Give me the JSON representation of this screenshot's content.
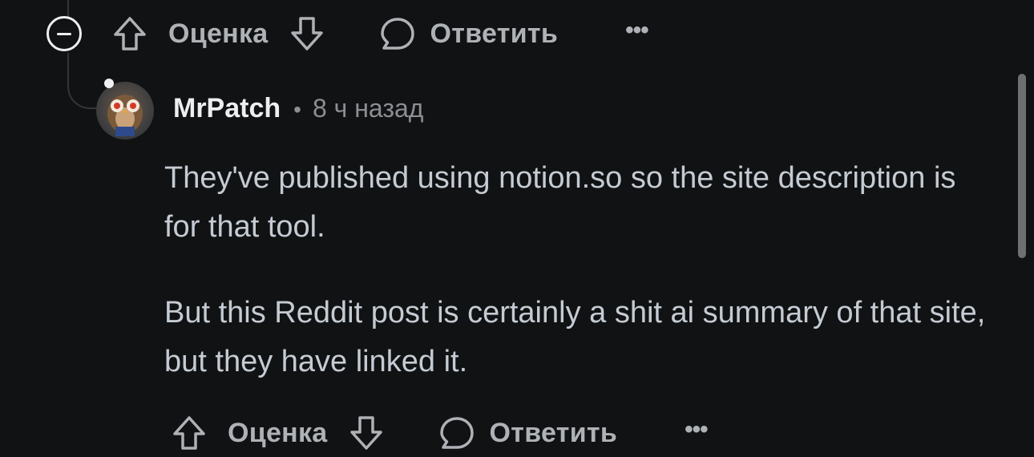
{
  "top_actions": {
    "score_label": "Оценка",
    "reply_label": "Ответить",
    "more_label": "•••"
  },
  "comment": {
    "username": "MrPatch",
    "separator": "•",
    "time": "8 ч назад",
    "paragraphs": [
      "They've published using notion.so so the site description is for that tool.",
      "But this Reddit post is certainly a shit ai summary of that site, but they have linked it."
    ],
    "actions": {
      "score_label": "Оценка",
      "reply_label": "Ответить",
      "more_label": "•••"
    }
  },
  "icons": {
    "collapse": "minus-circle-icon",
    "upvote": "arrow-up-icon",
    "downvote": "arrow-down-icon",
    "reply": "speech-bubble-icon",
    "more": "ellipsis-icon"
  },
  "colors": {
    "background": "#111213",
    "text_primary": "#eceef0",
    "text_secondary": "#aeb2b6",
    "text_body": "#c4cbd3"
  }
}
